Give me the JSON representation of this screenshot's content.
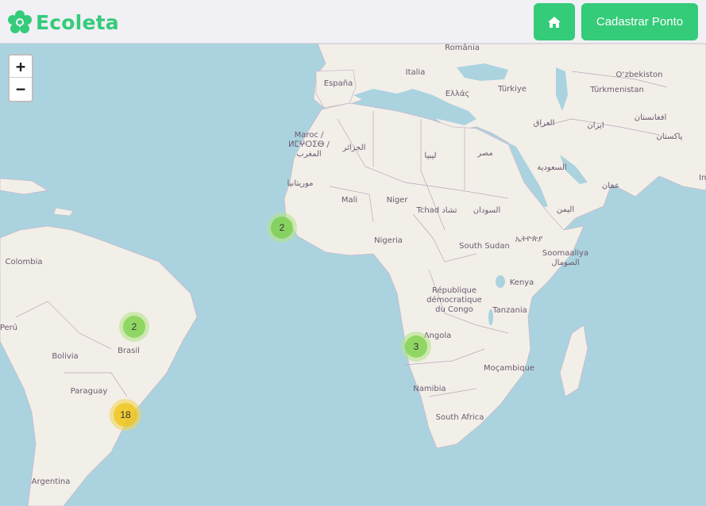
{
  "header": {
    "brand": "Ecoleta",
    "home_button_icon": "home-icon",
    "register_button": "Cadastrar Ponto",
    "accent_color": "#34cb79"
  },
  "map": {
    "zoom_in": "+",
    "zoom_out": "−",
    "labels": {
      "romania": "România",
      "italia": "Italia",
      "espana": "España",
      "ellas": "Ελλάς",
      "turkiye": "Türkiye",
      "ozbekiston": "O‘zbekiston",
      "turkmenistan": "Türkmenistan",
      "iraq": "العراق",
      "iran": "ایران",
      "afghanistan": "افغانستان",
      "pakistan": "پاکستان",
      "maroc1": "Maroc /",
      "maroc2": "ⵍⵎⵖⵔⵉⴱ /",
      "maroc3": "المغرب",
      "algeria": "الجزائر",
      "libya": "ليبيا",
      "egypt": "مصر",
      "saudi": "السعودية",
      "oman": "عمان",
      "yemen": "اليمن",
      "mauritania": "موريتانيا",
      "mali": "Mali",
      "niger": "Niger",
      "tchad": "Tchad تشاد",
      "sudan": "السودان",
      "nigeria": "Nigeria",
      "south_sudan": "South Sudan",
      "ethiopia": "ኢትዮጵያ",
      "somalia1": "Soomaaliya",
      "somalia2": "الصومال",
      "drc1": "République",
      "drc2": "démocratique",
      "drc3": "du Congo",
      "kenya": "Kenya",
      "tanzania": "Tanzania",
      "angola": "Angola",
      "mozambique": "Moçambique",
      "namibia": "Namibia",
      "south_africa": "South Africa",
      "colombia": "Colombia",
      "peru": "Perú",
      "brasil": "Brasil",
      "bolivia": "Bolivia",
      "paraguay": "Paraguay",
      "argentina": "Argentina",
      "india_partial": "In"
    },
    "clusters": [
      {
        "count": "2",
        "level": "green"
      },
      {
        "count": "2",
        "level": "green"
      },
      {
        "count": "3",
        "level": "green"
      },
      {
        "count": "18",
        "level": "yellow"
      }
    ],
    "colors": {
      "water": "#aad3df",
      "land": "#f2efe9",
      "border": "#b9a8b9"
    }
  }
}
